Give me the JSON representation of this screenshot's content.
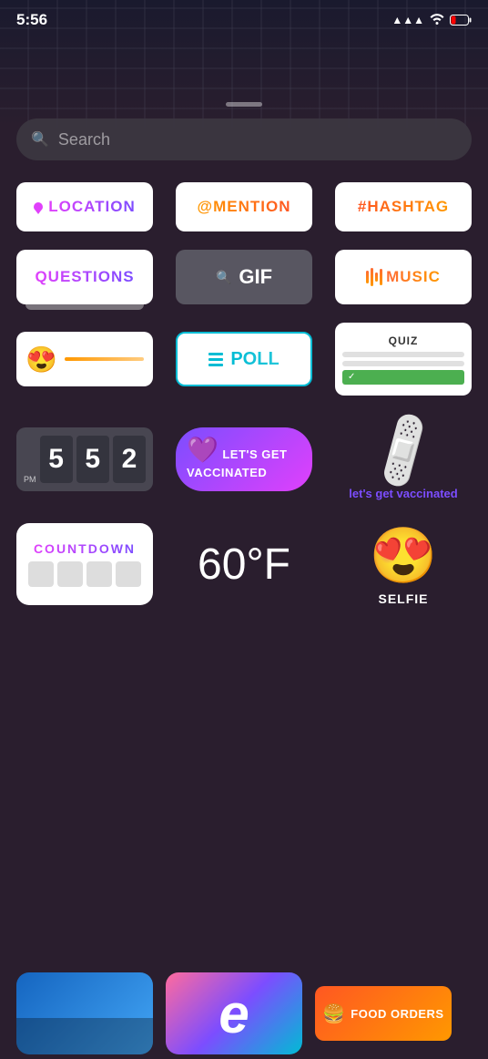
{
  "statusBar": {
    "time": "5:56",
    "signal": "▲▲▲",
    "wifi": "wifi",
    "battery": "🔋"
  },
  "search": {
    "placeholder": "Search"
  },
  "stickers": {
    "location": "LOCATION",
    "mention": "@MENTION",
    "hashtag": "#HASHTAG",
    "questions": "QUESTIONS",
    "gif": "GIF",
    "music": "MUSIC",
    "poll": "POLL",
    "quiz": "QUIZ",
    "vaccinated": "LET'S GET VACCINATED",
    "bandaidCaption": "let's get vaccinated",
    "countdownTitle": "COUNTDOWN",
    "weather": "60°F",
    "selfie": "SELFIE",
    "foodOrders": "FOOD ORDERS",
    "clock": {
      "period": "PM",
      "digits": [
        "5",
        "5",
        "2"
      ]
    }
  }
}
